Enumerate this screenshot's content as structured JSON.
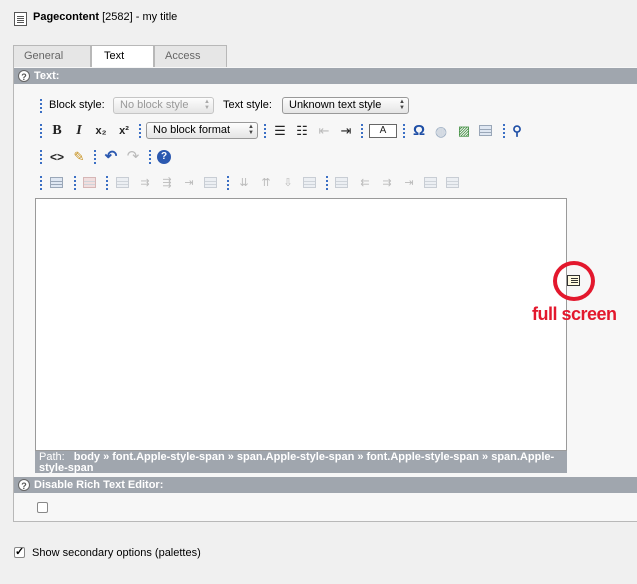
{
  "header": {
    "record_type": "Pagecontent",
    "record_id": "[2582]",
    "record_title": "- my title"
  },
  "tabs": [
    {
      "label": "General",
      "active": false
    },
    {
      "label": "Text",
      "active": true
    },
    {
      "label": "Access",
      "active": false
    }
  ],
  "sections": {
    "text": "Text:",
    "disable_rte": "Disable Rich Text Editor:"
  },
  "toolbar": {
    "block_style_label": "Block style:",
    "block_style_value": "No block style",
    "text_style_label": "Text style:",
    "text_style_value": "Unknown text style",
    "block_format_value": "No block format",
    "bold_glyph": "B",
    "italic_glyph": "I",
    "subscript_glyph": "x₂",
    "superscript_glyph": "x²",
    "source_glyph": "<>",
    "text_color_glyph": "A",
    "special_char_glyph": "Ω"
  },
  "path": {
    "label": "Path:",
    "items": "body » font.Apple-style-span » span.Apple-style-span » font.Apple-style-span » span.Apple-style-span"
  },
  "annotation": {
    "label": "full screen",
    "color": "#e3182d"
  },
  "disable_rte_checked": false,
  "secondary_options": {
    "label": "Show secondary options (palettes)",
    "checked": true
  }
}
